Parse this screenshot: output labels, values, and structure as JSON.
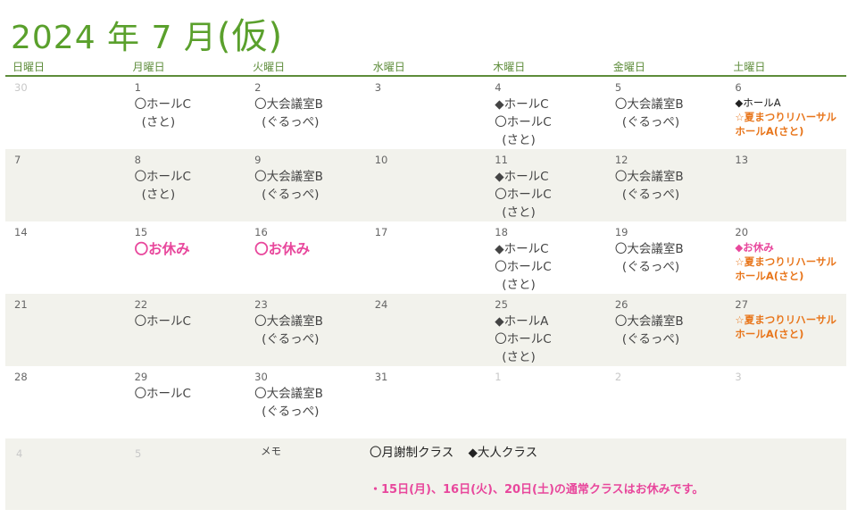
{
  "title": {
    "main": "2024 年 7 月",
    "suffix": "(仮)"
  },
  "weekdays": [
    "日曜日",
    "月曜日",
    "火曜日",
    "水曜日",
    "木曜日",
    "金曜日",
    "土曜日"
  ],
  "weeks": [
    [
      {
        "num": "30",
        "gray": true,
        "events": []
      },
      {
        "num": "1",
        "events": [
          {
            "t": "〇ホールC"
          },
          {
            "t": "(さと)",
            "indent": true
          }
        ]
      },
      {
        "num": "2",
        "events": [
          {
            "t": "〇大会議室B"
          },
          {
            "t": "(ぐるっぺ)",
            "indent": true
          }
        ]
      },
      {
        "num": "3",
        "events": []
      },
      {
        "num": "4",
        "events": [
          {
            "t": "◆ホールC"
          },
          {
            "t": "〇ホールC"
          },
          {
            "t": "(さと)",
            "indent": true
          }
        ]
      },
      {
        "num": "5",
        "events": [
          {
            "t": "〇大会議室B"
          },
          {
            "t": "(ぐるっぺ)",
            "indent": true
          }
        ]
      },
      {
        "num": "6",
        "events": [
          {
            "t": "◆ホールA",
            "style": "small"
          },
          {
            "t": "☆夏まつりリハーサル",
            "style": "small orange"
          },
          {
            "t": "ホールA(さと)",
            "style": "small orange"
          }
        ]
      }
    ],
    [
      {
        "num": "7",
        "events": []
      },
      {
        "num": "8",
        "events": [
          {
            "t": "〇ホールC"
          },
          {
            "t": "(さと)",
            "indent": true
          }
        ]
      },
      {
        "num": "9",
        "events": [
          {
            "t": "〇大会議室B"
          },
          {
            "t": "(ぐるっぺ)",
            "indent": true
          }
        ]
      },
      {
        "num": "10",
        "events": []
      },
      {
        "num": "11",
        "events": [
          {
            "t": "◆ホールC"
          },
          {
            "t": "〇ホールC"
          },
          {
            "t": "(さと)",
            "indent": true
          }
        ]
      },
      {
        "num": "12",
        "events": [
          {
            "t": "〇大会議室B"
          },
          {
            "t": "(ぐるっぺ)",
            "indent": true
          }
        ]
      },
      {
        "num": "13",
        "events": []
      }
    ],
    [
      {
        "num": "14",
        "events": []
      },
      {
        "num": "15",
        "events": [
          {
            "t": "〇お休み",
            "style": "off"
          }
        ]
      },
      {
        "num": "16",
        "events": [
          {
            "t": "〇お休み",
            "style": "off"
          }
        ]
      },
      {
        "num": "17",
        "events": []
      },
      {
        "num": "18",
        "events": [
          {
            "t": "◆ホールC"
          },
          {
            "t": "〇ホールC"
          },
          {
            "t": "(さと)",
            "indent": true
          }
        ]
      },
      {
        "num": "19",
        "events": [
          {
            "t": "〇大会議室B"
          },
          {
            "t": "(ぐるっぺ)",
            "indent": true
          }
        ]
      },
      {
        "num": "20",
        "events": [
          {
            "t": "◆お休み",
            "style": "small pink"
          },
          {
            "t": "☆夏まつりリハーサル",
            "style": "small orange"
          },
          {
            "t": "ホールA(さと)",
            "style": "small orange"
          }
        ]
      }
    ],
    [
      {
        "num": "21",
        "events": []
      },
      {
        "num": "22",
        "events": [
          {
            "t": "〇ホールC"
          }
        ]
      },
      {
        "num": "23",
        "events": [
          {
            "t": "〇大会議室B"
          },
          {
            "t": "(ぐるっぺ)",
            "indent": true
          }
        ]
      },
      {
        "num": "24",
        "events": []
      },
      {
        "num": "25",
        "events": [
          {
            "t": "◆ホールA"
          },
          {
            "t": "〇ホールC"
          },
          {
            "t": "(さと)",
            "indent": true
          }
        ]
      },
      {
        "num": "26",
        "events": [
          {
            "t": "〇大会議室B"
          },
          {
            "t": "(ぐるっぺ)",
            "indent": true
          }
        ]
      },
      {
        "num": "27",
        "events": [
          {
            "t": "☆夏まつりリハーサル",
            "style": "small orange"
          },
          {
            "t": "ホールA(さと)",
            "style": "small orange"
          }
        ]
      }
    ],
    [
      {
        "num": "28",
        "events": []
      },
      {
        "num": "29",
        "events": [
          {
            "t": "〇ホールC"
          }
        ]
      },
      {
        "num": "30",
        "events": [
          {
            "t": "〇大会議室B"
          },
          {
            "t": "(ぐるっぺ)",
            "indent": true
          }
        ]
      },
      {
        "num": "31",
        "events": []
      },
      {
        "num": "1",
        "gray": true,
        "events": []
      },
      {
        "num": "2",
        "gray": true,
        "events": []
      },
      {
        "num": "3",
        "gray": true,
        "events": []
      }
    ]
  ],
  "memo": {
    "day4": "4",
    "day5": "5",
    "label": "メモ",
    "legend_monthly": "〇月謝制クラス",
    "legend_adult": "◆大人クラス",
    "note": "・15日(月)、16日(火)、20日(土)の通常クラスはお休みです。"
  }
}
